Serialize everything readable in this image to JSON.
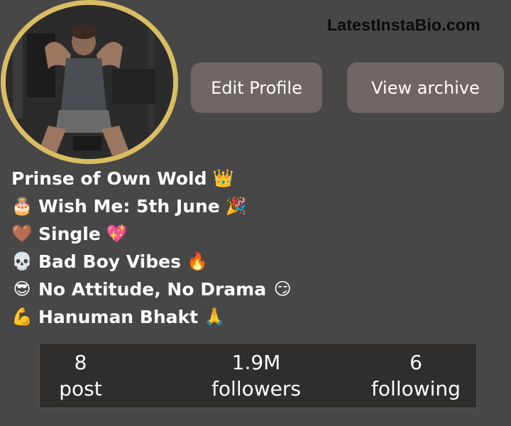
{
  "watermark": "LatestInstaBio.com",
  "profile": {
    "buttons": {
      "edit": "Edit Profile",
      "archive": "View archive"
    }
  },
  "bio": [
    {
      "text": "Prinse of Own Wold",
      "lead": "",
      "trail": "👑"
    },
    {
      "text": "Wish Me: 5th June",
      "lead": "🎂",
      "trail": "🎉"
    },
    {
      "text": "Single",
      "lead": "🤎",
      "trail": "💖"
    },
    {
      "text": "Bad Boy Vibes",
      "lead": "💀",
      "trail": "🔥"
    },
    {
      "text": "No Attitude, No Drama",
      "lead": "😎",
      "trail": "😏"
    },
    {
      "text": "Hanuman Bhakt",
      "lead": "💪",
      "trail": "🙏"
    }
  ],
  "stats": {
    "posts": {
      "value": "8",
      "label": "post"
    },
    "followers": {
      "value": "1.9M",
      "label": "followers"
    },
    "following": {
      "value": "6",
      "label": "following"
    }
  },
  "colors": {
    "background": "#474747",
    "ring": "#d9bd62",
    "button": "#6f6765",
    "stats_panel": "#302d2d"
  }
}
